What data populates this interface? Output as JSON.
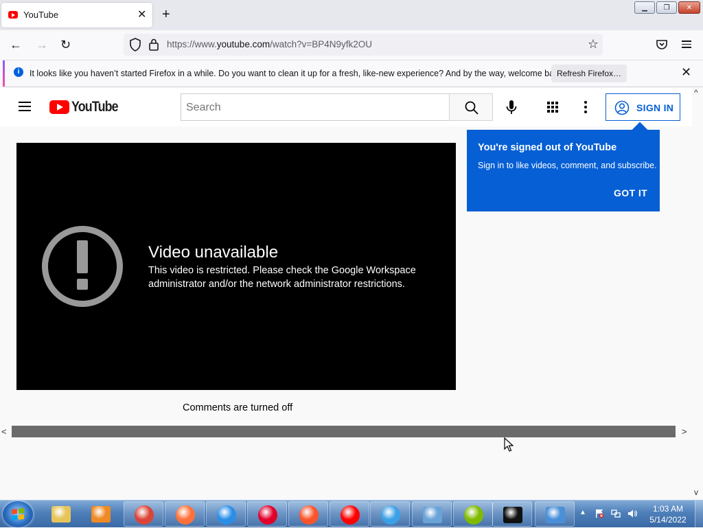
{
  "browser": {
    "tab": {
      "title": "YouTube",
      "close": "✕"
    },
    "new_tab": "+",
    "window_buttons": {
      "minimize": "▁",
      "restore": "❐",
      "close": "✕"
    },
    "nav": {
      "back": "←",
      "forward": "→",
      "reload": "↻"
    },
    "url": {
      "prefix": "https://www.",
      "domain": "youtube.com",
      "path": "/watch?v=BP4N9yfk2OU"
    },
    "infobar": {
      "icon": "i",
      "message": "It looks like you haven’t started Firefox in a while. Do you want to clean it up for a fresh, like-new experience? And by the way, welcome back!",
      "button": "Refresh Firefox…",
      "close": "✕"
    }
  },
  "youtube": {
    "wordmark": "YouTube",
    "search_placeholder": "Search",
    "sign_in": "SIGN IN",
    "player": {
      "title": "Video unavailable",
      "message": "This video is restricted. Please check the Google Workspace administrator and/or the network administrator restrictions."
    },
    "comments_status": "Comments are turned off",
    "callout": {
      "title": "You're signed out of YouTube",
      "body": "Sign in to like videos, comment, and subscribe.",
      "button": "GOT IT"
    }
  },
  "scrollbar": {
    "left": "<",
    "right": ">",
    "up": "^",
    "down": "v"
  },
  "taskbar": {
    "clock": {
      "time": "1:03 AM",
      "date": "5/14/2022"
    },
    "tray_expand": "▲",
    "apps": [
      {
        "name": "file-explorer",
        "color": "#e7c45a"
      },
      {
        "name": "media-player",
        "color": "#f08a24"
      },
      {
        "name": "chrome",
        "color": "#db4437"
      },
      {
        "name": "firefox",
        "color": "#ff7139"
      },
      {
        "name": "firefox-developer",
        "color": "#2a8ee8"
      },
      {
        "name": "opera",
        "color": "#e0002a"
      },
      {
        "name": "brave",
        "color": "#fb542b"
      },
      {
        "name": "yandex",
        "color": "#ff0000"
      },
      {
        "name": "internet-explorer",
        "color": "#3ba0e6"
      },
      {
        "name": "control-panel",
        "color": "#6aa3d8"
      },
      {
        "name": "windows-update",
        "color": "#7fba00"
      },
      {
        "name": "command-prompt",
        "color": "#111111"
      },
      {
        "name": "remote-desktop",
        "color": "#4a90d9"
      }
    ]
  }
}
